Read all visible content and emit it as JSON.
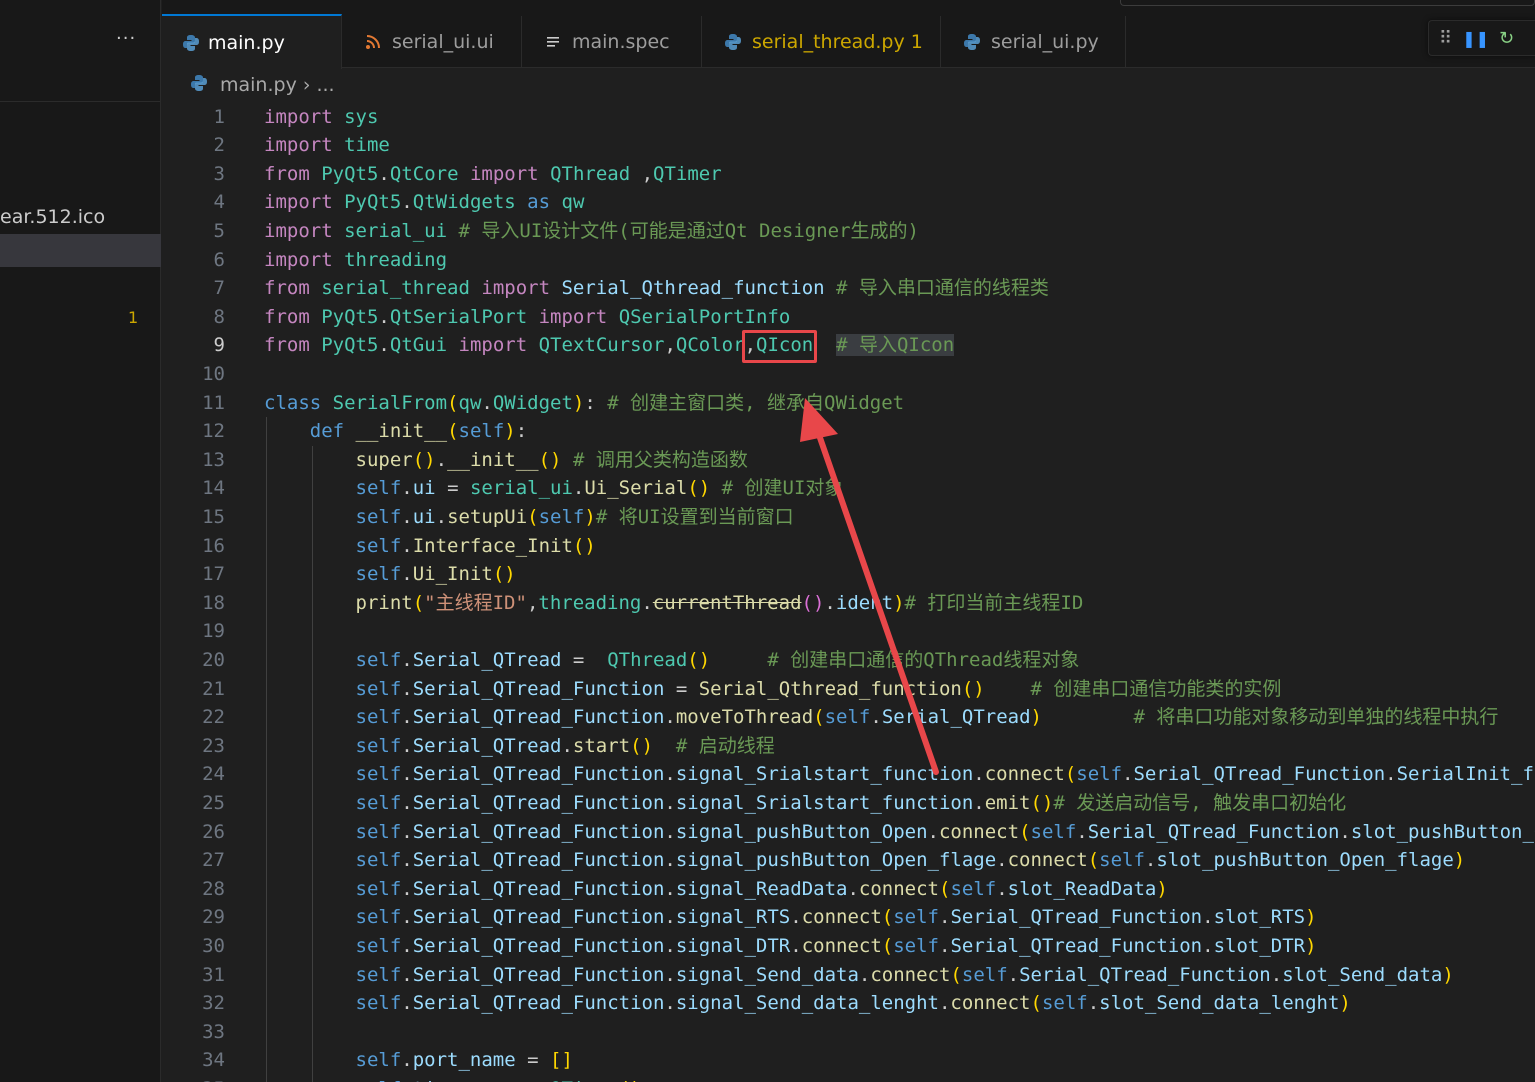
{
  "sidebar": {
    "more_label": "···",
    "file_label": "ear.512.ico",
    "badge": "1"
  },
  "tabs": [
    {
      "label": "main.py",
      "icon": "python-icon",
      "active": true,
      "modified": true
    },
    {
      "label": "serial_ui.ui",
      "icon": "rss-icon"
    },
    {
      "label": "main.spec",
      "icon": "lines-icon"
    },
    {
      "label": "serial_thread.py",
      "icon": "python-icon",
      "problems": "1"
    },
    {
      "label": "serial_ui.py",
      "icon": "python-icon"
    }
  ],
  "debug_toolbar": {
    "grip": "⠿",
    "pause": "❚❚",
    "restart": "↻"
  },
  "breadcrumb": {
    "file": "main.py",
    "separator": "›",
    "rest": "..."
  },
  "editor": {
    "current_line": 9,
    "lines": [
      {
        "n": 1,
        "text": "import sys"
      },
      {
        "n": 2,
        "text": "import time"
      },
      {
        "n": 3,
        "text": "from PyQt5.QtCore import QThread ,QTimer"
      },
      {
        "n": 4,
        "text": "import PyQt5.QtWidgets as qw"
      },
      {
        "n": 5,
        "text": "import serial_ui # 导入UI设计文件(可能是通过Qt Designer生成的)"
      },
      {
        "n": 6,
        "text": "import threading"
      },
      {
        "n": 7,
        "text": "from serial_thread import Serial_Qthread_function # 导入串口通信的线程类"
      },
      {
        "n": 8,
        "text": "from PyQt5.QtSerialPort import QSerialPortInfo"
      },
      {
        "n": 9,
        "text": "from PyQt5.QtGui import QTextCursor,QColor,QIcon  # 导入QIcon"
      },
      {
        "n": 10,
        "text": ""
      },
      {
        "n": 11,
        "text": "class SerialFrom(qw.QWidget): # 创建主窗口类, 继承自QWidget"
      },
      {
        "n": 12,
        "text": "    def __init__(self):"
      },
      {
        "n": 13,
        "text": "        super().__init__() # 调用父类构造函数"
      },
      {
        "n": 14,
        "text": "        self.ui = serial_ui.Ui_Serial() # 创建UI对象"
      },
      {
        "n": 15,
        "text": "        self.ui.setupUi(self)# 将UI设置到当前窗口"
      },
      {
        "n": 16,
        "text": "        self.Interface_Init()"
      },
      {
        "n": 17,
        "text": "        self.Ui_Init()"
      },
      {
        "n": 18,
        "text": "        print(\"主线程ID\",threading.currentThread().ident)# 打印当前主线程ID"
      },
      {
        "n": 19,
        "text": ""
      },
      {
        "n": 20,
        "text": "        self.Serial_QTread =  QThread()     # 创建串口通信的QThread线程对象"
      },
      {
        "n": 21,
        "text": "        self.Serial_QTread_Function = Serial_Qthread_function()    # 创建串口通信功能类的实例"
      },
      {
        "n": 22,
        "text": "        self.Serial_QTread_Function.moveToThread(self.Serial_QTread)        # 将串口功能对象移动到单独的线程中执行"
      },
      {
        "n": 23,
        "text": "        self.Serial_QTread.start()  # 启动线程"
      },
      {
        "n": 24,
        "text": "        self.Serial_QTread_Function.signal_Srialstart_function.connect(self.Serial_QTread_Function.SerialInit_function)"
      },
      {
        "n": 25,
        "text": "        self.Serial_QTread_Function.signal_Srialstart_function.emit()# 发送启动信号, 触发串口初始化"
      },
      {
        "n": 26,
        "text": "        self.Serial_QTread_Function.signal_pushButton_Open.connect(self.Serial_QTread_Function.slot_pushButton_Open)"
      },
      {
        "n": 27,
        "text": "        self.Serial_QTread_Function.signal_pushButton_Open_flage.connect(self.slot_pushButton_Open_flage)"
      },
      {
        "n": 28,
        "text": "        self.Serial_QTread_Function.signal_ReadData.connect(self.slot_ReadData)"
      },
      {
        "n": 29,
        "text": "        self.Serial_QTread_Function.signal_RTS.connect(self.Serial_QTread_Function.slot_RTS)"
      },
      {
        "n": 30,
        "text": "        self.Serial_QTread_Function.signal_DTR.connect(self.Serial_QTread_Function.slot_DTR)"
      },
      {
        "n": 31,
        "text": "        self.Serial_QTread_Function.signal_Send_data.connect(self.Serial_QTread_Function.slot_Send_data)"
      },
      {
        "n": 32,
        "text": "        self.Serial_QTread_Function.signal_Send_data_lenght.connect(self.slot_Send_data_lenght)"
      },
      {
        "n": 33,
        "text": ""
      },
      {
        "n": 34,
        "text": "        self.port_name = []"
      },
      {
        "n": 35,
        "text": "        self.time_scan = QTimer()"
      }
    ]
  },
  "colors": {
    "background": "#1f1f1f",
    "sidebar": "#181818",
    "accent": "#0078d4",
    "annotation": "#e8474a",
    "warning": "#cca700"
  }
}
